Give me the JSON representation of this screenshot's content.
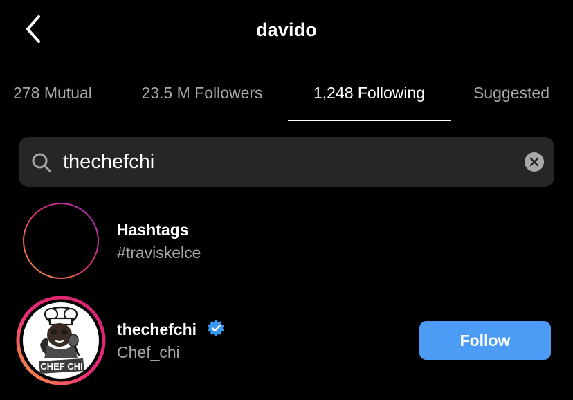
{
  "header": {
    "title": "davido",
    "back_icon": "chevron-left-icon"
  },
  "tabs": [
    {
      "label": "278 Mutual",
      "active": false
    },
    {
      "label": "23.5 M Followers",
      "active": false
    },
    {
      "label": "1,248 Following",
      "active": true
    },
    {
      "label": "Suggested",
      "active": false
    }
  ],
  "search": {
    "value": "thechefchi",
    "icon": "search-icon",
    "clear_icon": "clear-icon"
  },
  "results": {
    "hashtags": {
      "title": "Hashtags",
      "subtitle": "#traviskelce",
      "icon": "hashtag-icon"
    },
    "user": {
      "username": "thechefchi",
      "full_name": "Chef_chi",
      "verified": true,
      "avatar_text": "CHEF CHI",
      "follow_label": "Follow"
    }
  },
  "colors": {
    "background": "#000000",
    "primary_text": "#ffffff",
    "secondary_text": "#a8a8a8",
    "search_bg": "#262626",
    "follow_button": "#4c9bf5",
    "verified_badge": "#3897f0"
  }
}
